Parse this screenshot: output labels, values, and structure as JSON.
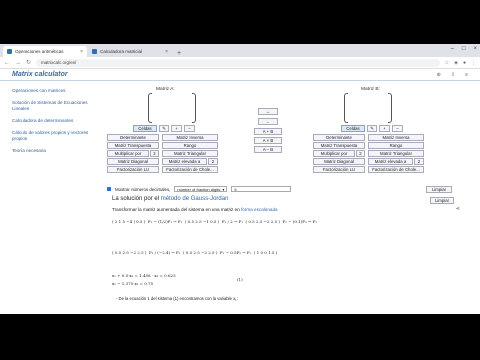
{
  "browser": {
    "tabs": [
      {
        "title": "Operaciones aritméticas",
        "active": true
      },
      {
        "title": "Calculadora matricial",
        "active": false
      }
    ],
    "url": "matrixcalc.org/es/"
  },
  "site": {
    "title": "Matrix calculator"
  },
  "sidebar": {
    "items": [
      "Operaciones con matrices",
      "Solución de Sistemas de Ecuaciones Lineales",
      "Calculadora de determinantes",
      "Cálculo de valores propios y vectores propios",
      "Teoría necesaria"
    ]
  },
  "matrixA": {
    "label": "Matriz A:",
    "cells_label": "Celdas",
    "plus": "+",
    "minus": "–",
    "buttons": [
      [
        "Determinante",
        "Matriz Inversa"
      ],
      [
        "Matriz Transpuesta",
        "Rango"
      ],
      [
        "Multiplicar por",
        "Matriz Triangular"
      ],
      [
        "Matriz Diagonal",
        "Matriz elevada a"
      ],
      [
        "Factorización LU",
        "Factorización de Chole..."
      ]
    ],
    "mult_value": "2",
    "pow_value": "2"
  },
  "matrixB": {
    "label": "Matriz B:",
    "cells_label": "Celdas",
    "plus": "+",
    "minus": "–",
    "buttons": [
      [
        "Determinante",
        "Matriz Inversa"
      ],
      [
        "Matriz Transpuesta",
        "Rango"
      ],
      [
        "Multiplicar por",
        "Matriz Triangular"
      ],
      [
        "Matriz Diagonal",
        "Matriz elevada a"
      ],
      [
        "Factorización LU",
        "Factorización de Chole..."
      ]
    ],
    "mult_value": "2",
    "pow_value": "2"
  },
  "middle": {
    "buttons": [
      "A + B",
      "A × B",
      "A – B"
    ],
    "swap": "↔",
    "copy_left": "←",
    "copy_right": "→"
  },
  "options": {
    "show_decimals": "Mostrar números decimales,",
    "digits_select": "number of fraction digits:",
    "digits_value": "5",
    "clear": "Limpiar"
  },
  "solution": {
    "title_prefix": "La solución por el",
    "title_link": "método de Gauss-Jordan",
    "clear": "Limpiar",
    "transform_text": "Transformar la matriz aumentada del sistema en una matriz en",
    "transform_link": "forma escalonada",
    "steps_row1": [
      "( 2  1  5  −4 | 0.5 )",
      "F₂ − (1/2)F₁ → F₂",
      "( 0.5  2.5  −1  0.5 )",
      "F₁ / 2 → F₁",
      "( 0.5  2.5  −2  2.5 )",
      "F₂ − (0.1)F₃ → F₂"
    ],
    "steps_row2": [
      "( 0.5  2.5  −2  2.5 )",
      "F₂ / (−2.4) → F₂",
      "( 0.5  2.5  −2  2.5 )",
      "F₁ − 0.5F₂ → F₁",
      "( 1  0  0  1.5 )"
    ],
    "equations": [
      "x₁  + 0.5·x₃  = 1.458 · x₃ = 0.625",
      "x₂  − 1.375·x₃ = 0.75"
    ],
    "eq_number": "(1)",
    "footnote": "- De la ecuación 1 del sistema (1) encontramos con la variable x₁:"
  }
}
